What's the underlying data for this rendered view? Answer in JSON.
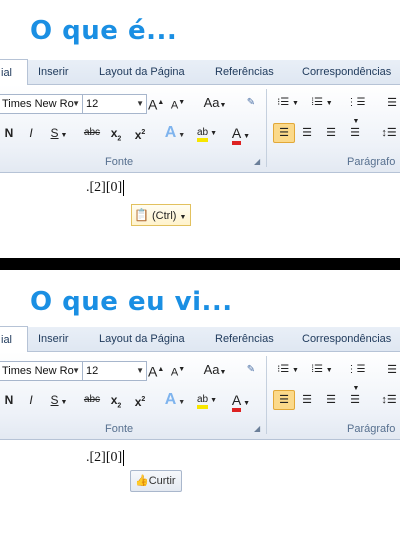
{
  "headlines": {
    "top": "O que é...",
    "bottom": "O que eu vi..."
  },
  "ribbon": {
    "tabs": [
      "ial",
      "Inserir",
      "Layout da Página",
      "Referências",
      "Correspondências"
    ],
    "font_name": "Times New Ro",
    "font_size": "12",
    "groups": {
      "font": "Fonte",
      "paragraph": "Parágrafo"
    },
    "buttons": {
      "grow": "A",
      "shrink": "A",
      "change_case": "Aa",
      "bold": "N",
      "italic": "I",
      "underline": "S",
      "strike": "abc",
      "subscript": "x",
      "superscript": "x",
      "effects": "A",
      "highlight": "ab",
      "font_color": "A"
    }
  },
  "document": {
    "text": ".[2][0]"
  },
  "paste_options": {
    "label": "(Ctrl)"
  },
  "like_button": {
    "label": "Curtir"
  },
  "colors": {
    "headline": "#1a8fe3",
    "highlight": "#f7e600",
    "font_color": "#d22"
  }
}
